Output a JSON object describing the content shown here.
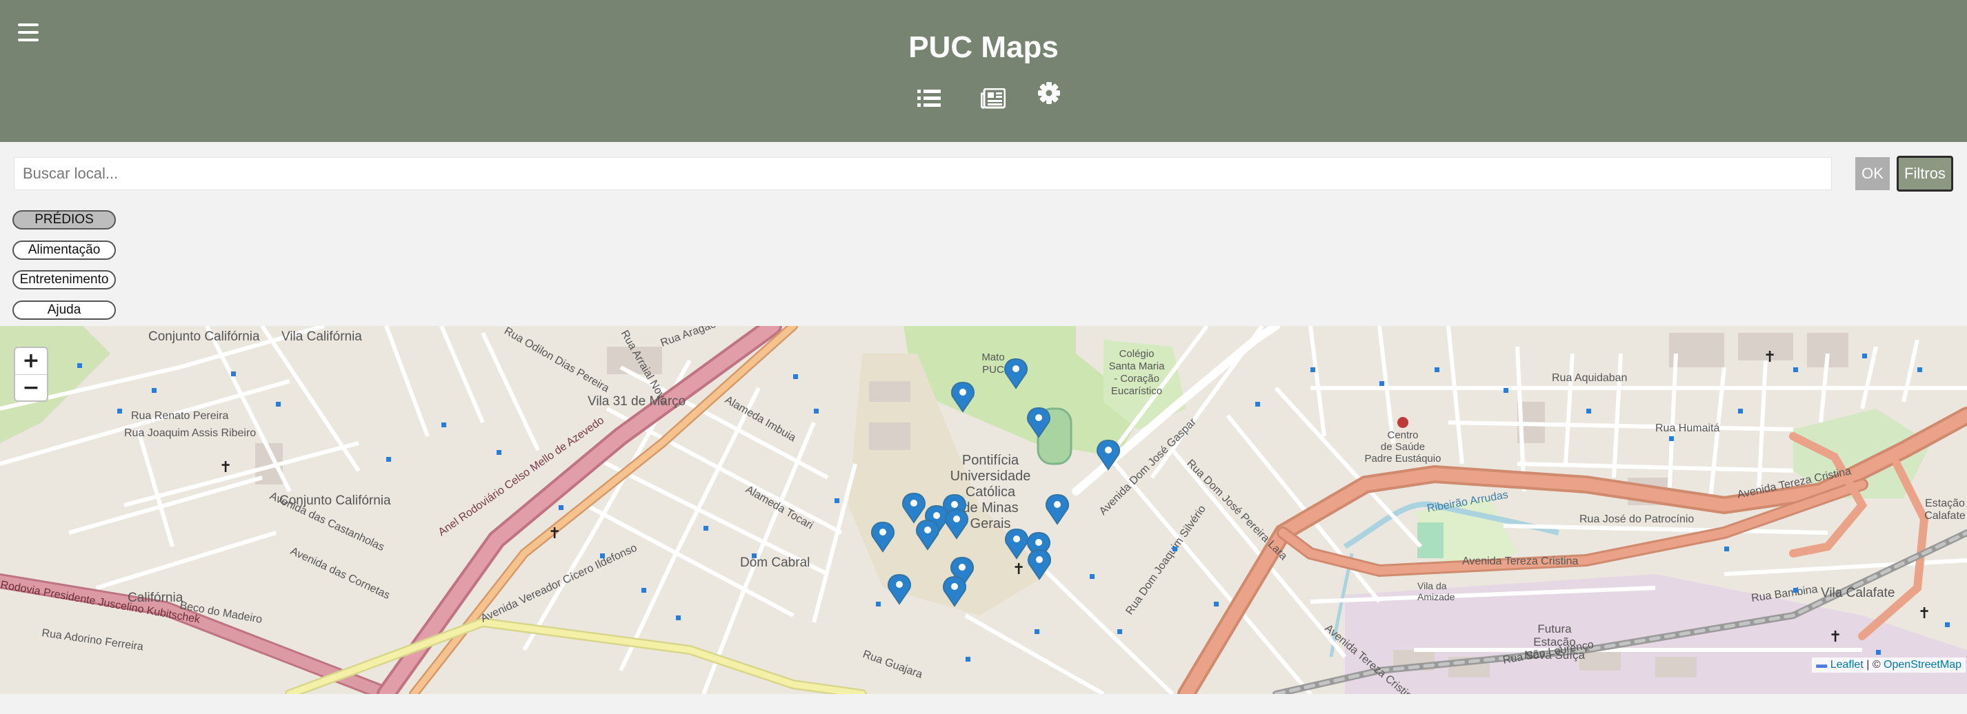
{
  "app": {
    "title": "PUC Maps"
  },
  "header": {
    "menu_icon": "hamburger-icon",
    "nav": [
      {
        "icon": "list-icon"
      },
      {
        "icon": "newspaper-icon"
      },
      {
        "icon": "gear-icon"
      }
    ]
  },
  "search": {
    "placeholder": "Buscar local...",
    "value": "",
    "ok_label": "OK",
    "filter_label": "Filtros"
  },
  "categories": [
    {
      "label": "PRÉDIOS",
      "active": true
    },
    {
      "label": "Alimentação",
      "active": false
    },
    {
      "label": "Entretenimento",
      "active": false
    },
    {
      "label": "Ajuda",
      "active": false
    }
  ],
  "map": {
    "zoom_in": "+",
    "zoom_out": "−",
    "attribution_leaflet": "Leaflet",
    "attribution_sep": " | © ",
    "attribution_osm": "OpenStreetMap",
    "labels": {
      "campus": [
        "Pontifícia",
        "Universidade",
        "Católica",
        "de Minas",
        "Gerais"
      ],
      "mato": [
        "Mato",
        "PUC"
      ],
      "colegio": [
        "Colégio",
        "Santa Maria",
        "- Coração",
        "Eucarístico"
      ],
      "conjunto_california_1": "Conjunto Califórnia",
      "conjunto_california_2": "Conjunto Califórnia",
      "vila_california": "Vila Califórnia",
      "california": "Califórnia",
      "dom_cabral": "Dom Cabral",
      "vila_31": "Vila 31 de Março",
      "centro_saude": [
        "Centro",
        "de Saúde",
        "Padre Eustáquio"
      ],
      "futura_estacao": [
        "Futura",
        "Estação",
        "Nova Suíça"
      ],
      "vila_amizade": [
        "Vila da",
        "Amizade"
      ],
      "vila_calafate": "Vila Calafate",
      "estacao_calafate": [
        "Estação",
        "Calafate"
      ],
      "anel_rodoviario": "Anel Rodoviário Celso Mello de Azevedo",
      "rodovia_jk": "Rodovia Presidente Juscelino Kubitschek",
      "av_tereza_1": "Avenida Tereza Cristina",
      "av_tereza_2": "Avenida Tereza Cristina",
      "av_tereza_3": "Avenida Tereza Cristina",
      "av_dom_jose_gaspar": "Avenida Dom José Gaspar",
      "av_castanholas": "Avenida das Castanholas",
      "av_cornetas": "Avenida das Cornetas",
      "av_vereador": "Avenida Vereador Cícero Ildefonso",
      "rua_aquidaban": "Rua Aquidaban",
      "rua_humaita": "Rua Humaitá",
      "rua_jose_patrocinio": "Rua José do Patrocínio",
      "rua_dom_silverio": "Rua Dom Joaquim Silvério",
      "rua_dom_jose_pereira": "Rua Dom José Pereira Lara",
      "rua_tocari": "Alameda Tocari",
      "rua_imbuia": "Alameda Imbuia",
      "rua_guajara": "Rua Guajara",
      "rua_renato": "Rua Renato Pereira",
      "rua_joaquim": "Rua Joaquim Assis Ribeiro",
      "ribeirao": "Ribeirão Arrudas",
      "rua_adorino": "Rua Adorino Ferreira",
      "rua_beco": "Beco do Madeiro",
      "rua_sao_lourenco": "Rua São Lourenço",
      "rua_bambina": "Rua Bambina",
      "rua_aragao": "Rua Aragão",
      "rua_arraial": "Rua Arraial Novo",
      "rua_odilon": "Rua Odilon Dias Pereira"
    },
    "markers_count": 17
  }
}
